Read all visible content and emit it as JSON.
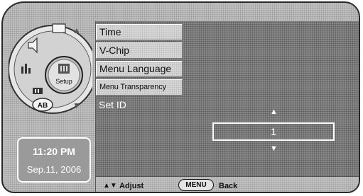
{
  "menu": {
    "items": [
      {
        "label": "Time"
      },
      {
        "label": "V-Chip"
      },
      {
        "label": "Menu Language"
      },
      {
        "label": "Menu Transparency"
      },
      {
        "label": "Set ID"
      }
    ]
  },
  "set_id": {
    "value": "1"
  },
  "footer": {
    "arrows": "▲▼",
    "adjust_label": "Adjust",
    "menu_label": "MENU",
    "back_label": "Back"
  },
  "wheel": {
    "center_label": "Setup",
    "ab_label": "AB"
  },
  "clock": {
    "time": "11:20 PM",
    "date": "Sep.11, 2006"
  }
}
